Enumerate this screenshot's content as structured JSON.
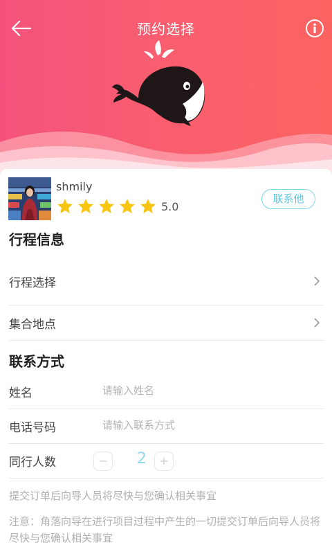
{
  "header": {
    "title": "预约选择"
  },
  "guide": {
    "name": "shmily",
    "rating": "5.0",
    "stars": 5,
    "contact_label": "联系他"
  },
  "trip_section": {
    "title": "行程信息",
    "items": [
      {
        "label": "行程选择"
      },
      {
        "label": "集合地点"
      }
    ]
  },
  "contact_section": {
    "title": "联系方式",
    "name_label": "姓名",
    "name_placeholder": "请输入姓名",
    "phone_label": "电话号码",
    "phone_placeholder": "请输入联系方式",
    "companions_label": "同行人数",
    "companions_minus": "−",
    "companions_value": "2",
    "companions_plus": "+"
  },
  "tips": {
    "submit_notice": "提交订单后向导人员将尽快与您确认相关事宜",
    "note": "注意：角落向导在进行项目过程中产生的一切提交订单后向导人员将尽快与您确认相关事宜"
  },
  "colors": {
    "accent": "#f95e6f",
    "contact": "#5bc9de",
    "star": "#f9c513"
  }
}
